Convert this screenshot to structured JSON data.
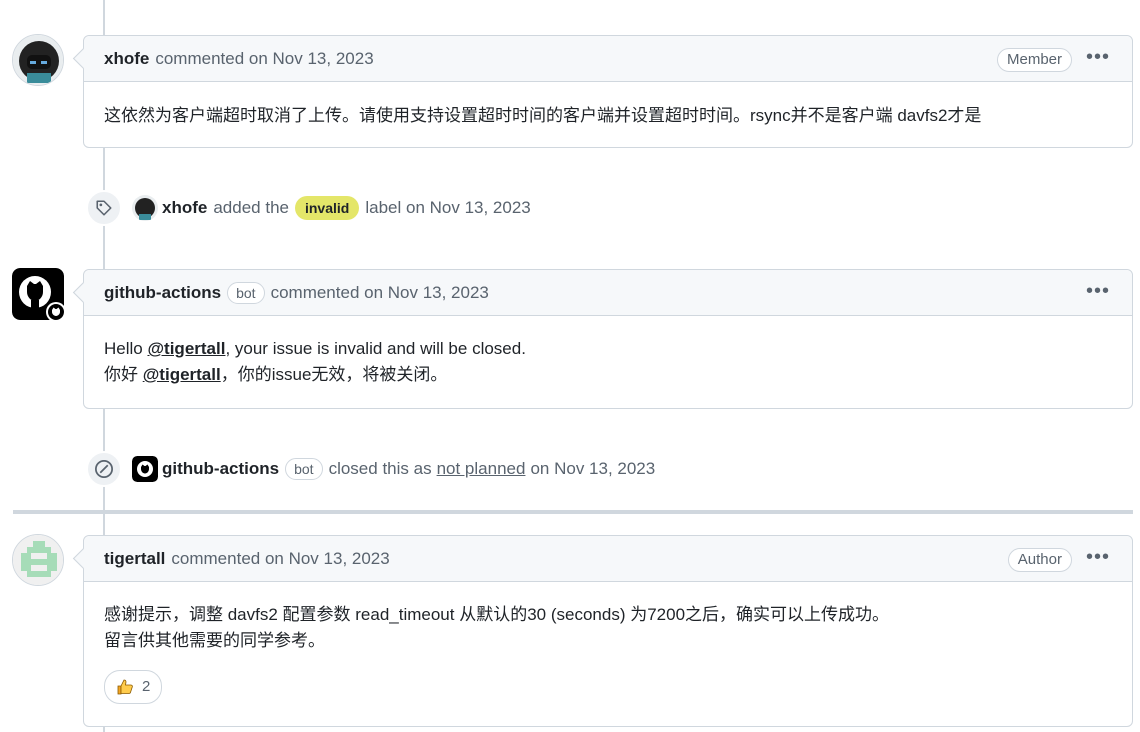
{
  "comments": [
    {
      "author": "xhofe",
      "meta": "commented on Nov 13, 2023",
      "role": "Member",
      "body": "这依然为客户端超时取消了上传。请使用支持设置超时时间的客户端并设置超时时间。rsync并不是客户端 davfs2才是"
    },
    {
      "author": "github-actions",
      "bot_label": "bot",
      "meta": "commented on Nov 13, 2023",
      "line1_prefix": "Hello ",
      "line1_mention": "@tigertall",
      "line1_suffix": ", your issue is invalid and will be closed.",
      "line2_prefix": "你好 ",
      "line2_mention": "@tigertall",
      "line2_suffix": "，你的issue无效，将被关闭。"
    },
    {
      "author": "tigertall",
      "meta": "commented on Nov 13, 2023",
      "role": "Author",
      "line1": "感谢提示，调整 davfs2 配置参数 read_timeout 从默认的30 (seconds) 为7200之后，确实可以上传成功。",
      "line2": "留言供其他需要的同学参考。",
      "reaction_count": "2"
    }
  ],
  "events": [
    {
      "actor": "xhofe",
      "text_before": "added the",
      "label": "invalid",
      "text_after": "label on Nov 13, 2023"
    },
    {
      "actor": "github-actions",
      "bot_label": "bot",
      "text_before": "closed this as",
      "link": "not planned",
      "text_after": "on Nov 13, 2023"
    }
  ],
  "kebab": "•••",
  "colors": {
    "label_invalid": "#e4e669",
    "border": "#d0d7de",
    "muted": "#59636e"
  },
  "icons": [
    "tag-icon",
    "closed-not-planned-icon",
    "thumbs-up-icon",
    "kebab-icon",
    "github-mark-icon"
  ]
}
